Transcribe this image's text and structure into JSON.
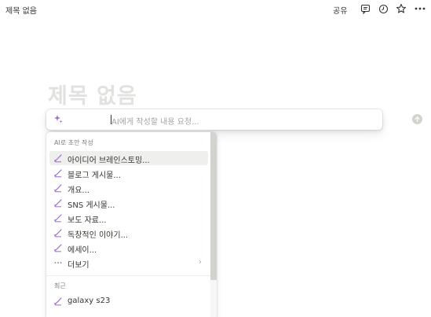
{
  "topbar": {
    "page_name": "제목 없음",
    "share_label": "공유",
    "icons": [
      "comment-icon",
      "clock-icon",
      "star-icon",
      "more-icon"
    ]
  },
  "page": {
    "title": "제목 없음"
  },
  "ai_prompt": {
    "placeholder": "AI에게 작성할 내용 요청..."
  },
  "menu": {
    "section_draft_label": "AI로 초안 작성",
    "draft_items": [
      {
        "label": "아이디어 브레인스토밍...",
        "icon": "pen-icon"
      },
      {
        "label": "블로그 게시물...",
        "icon": "pen-icon"
      },
      {
        "label": "개요...",
        "icon": "pen-icon"
      },
      {
        "label": "SNS 게시물...",
        "icon": "pen-icon"
      },
      {
        "label": "보도 자료...",
        "icon": "pen-icon"
      },
      {
        "label": "독창적인 이야기...",
        "icon": "pen-icon"
      },
      {
        "label": "에세이...",
        "icon": "pen-icon"
      },
      {
        "label": "더보기",
        "icon": "ellipsis-icon",
        "chevron": "›"
      }
    ],
    "section_recent_label": "최근",
    "recent_items": [
      {
        "label": "galaxy s23",
        "icon": "pen-icon"
      }
    ]
  },
  "colors": {
    "text": "#37352f",
    "muted": "#7d7c78",
    "placeholder": "#a5a4a0",
    "title_placeholder": "#e1e1df",
    "ai_accent": "#9b6bd0",
    "hover_bg": "#efefee"
  }
}
